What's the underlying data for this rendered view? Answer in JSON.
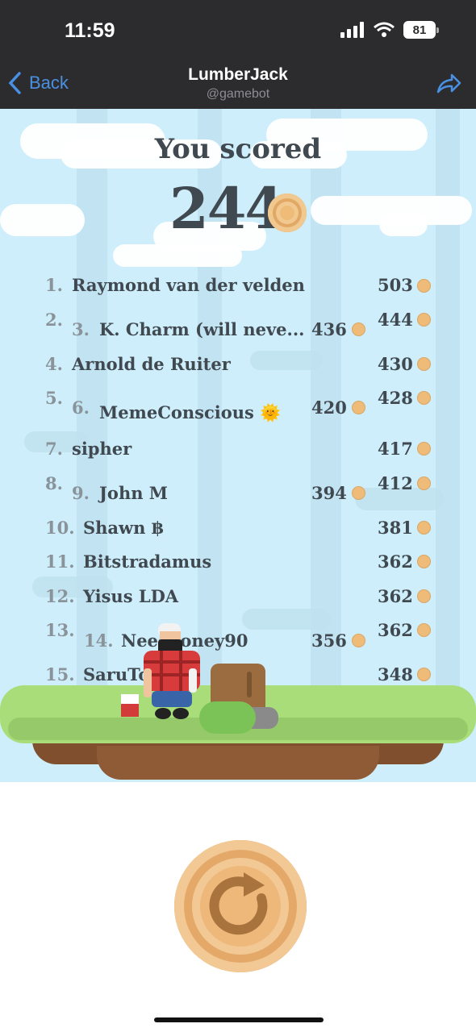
{
  "status": {
    "time": "11:59",
    "battery": "81"
  },
  "nav": {
    "back_label": "Back",
    "title": "LumberJack",
    "subtitle": "@gamebot"
  },
  "game": {
    "score_title": "You scored",
    "score": "244",
    "leaderboard_left": [
      {
        "rank": "1.",
        "name": "Raymond van der velden",
        "score": "503"
      },
      {
        "rank": "2.",
        "name": "",
        "score": "444"
      },
      {
        "rank": "3.",
        "name": "K. Charm (will neve...",
        "score": "436"
      },
      {
        "rank": "4.",
        "name": "Arnold de Ruiter",
        "score": "430"
      },
      {
        "rank": "5.",
        "name": "",
        "score": "428"
      },
      {
        "rank": "6.",
        "name": "MemeConscious 🌞",
        "score": "420"
      },
      {
        "rank": "7.",
        "name": "sipher",
        "score": "417"
      },
      {
        "rank": "8.",
        "name": "",
        "score": "412"
      },
      {
        "rank": "9.",
        "name": "John M",
        "score": "394"
      },
      {
        "rank": "10.",
        "name": "Shawn ฿",
        "score": "381"
      },
      {
        "rank": "11.",
        "name": "Bitstradamus",
        "score": "362"
      },
      {
        "rank": "12.",
        "name": "Yisus LDA",
        "score": "362"
      },
      {
        "rank": "13.",
        "name": "",
        "score": "362"
      },
      {
        "rank": "14.",
        "name": "Neecdoney90",
        "score": "356"
      },
      {
        "rank": "15.",
        "name": "SaruTo",
        "score": "348"
      }
    ]
  },
  "colors": {
    "sky": "#cdeefa",
    "coin": "#eebc78",
    "grass": "#a9dd7a",
    "dirt": "#7f4f2e",
    "accent_blue": "#4a90e2"
  },
  "icons": {
    "back": "chevron-left-icon",
    "share": "share-arrow-icon",
    "restart": "restart-icon",
    "signal": "signal-icon",
    "wifi": "wifi-icon"
  }
}
